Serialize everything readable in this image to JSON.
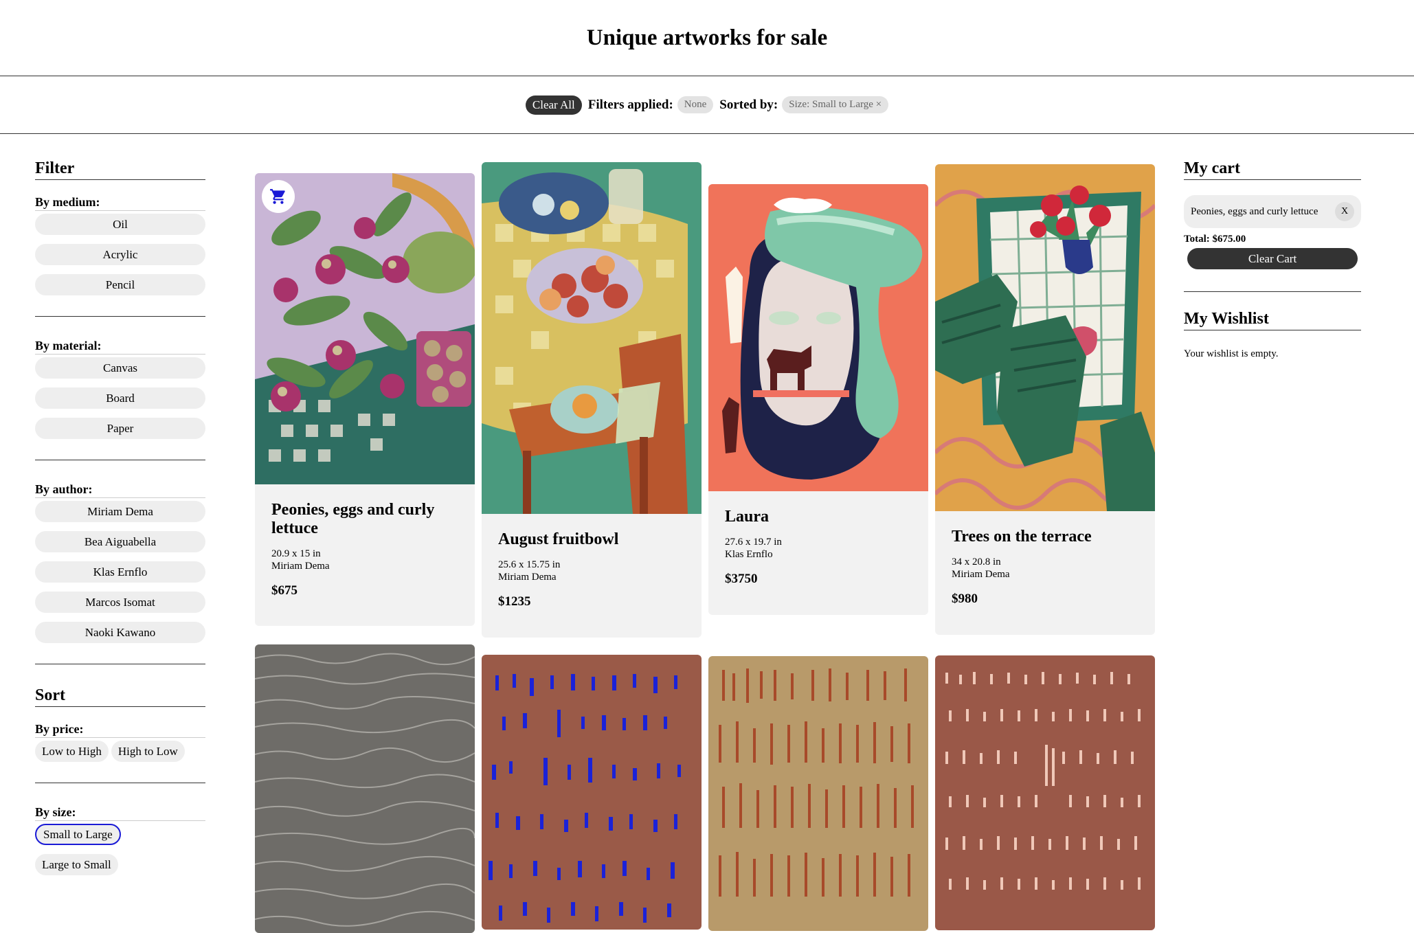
{
  "header": {
    "title": "Unique artworks for sale"
  },
  "filter_bar": {
    "clear_all": "Clear All",
    "filters_label": "Filters applied:",
    "filters_value": "None",
    "sorted_label": "Sorted by:",
    "sorted_value": "Size: Small to Large ×"
  },
  "sidebar": {
    "filter_title": "Filter",
    "medium_label": "By medium:",
    "mediums": [
      "Oil",
      "Acrylic",
      "Pencil"
    ],
    "material_label": "By material:",
    "materials": [
      "Canvas",
      "Board",
      "Paper"
    ],
    "author_label": "By author:",
    "authors": [
      "Miriam Dema",
      "Bea Aiguabella",
      "Klas Ernflo",
      "Marcos Isomat",
      "Naoki Kawano"
    ],
    "sort_title": "Sort",
    "price_label": "By price:",
    "price_options": [
      "Low to High",
      "High to Low"
    ],
    "size_label": "By size:",
    "size_options": [
      "Small to Large",
      "Large to Small"
    ],
    "size_selected": "Small to Large"
  },
  "products": [
    {
      "title": "Peonies, eggs and curly lettuce",
      "size": "20.9 x 15 in",
      "author": "Miriam Dema",
      "price": "$675"
    },
    {
      "title": "August fruitbowl",
      "size": "25.6 x 15.75 in",
      "author": "Miriam Dema",
      "price": "$1235"
    },
    {
      "title": "Laura",
      "size": "27.6 x 19.7 in",
      "author": "Klas Ernflo",
      "price": "$3750"
    },
    {
      "title": "Trees on the terrace",
      "size": "34 x 20.8 in",
      "author": "Miriam Dema",
      "price": "$980"
    }
  ],
  "cart": {
    "title": "My cart",
    "items": [
      "Peonies, eggs and curly lettuce"
    ],
    "remove_label": "X",
    "total": "Total: $675.00",
    "clear_label": "Clear Cart"
  },
  "wishlist": {
    "title": "My Wishlist",
    "empty_text": "Your wishlist is empty."
  },
  "icons": {
    "cart_badge": "shopping-cart-icon"
  },
  "colors": {
    "accent": "#1a1ad6",
    "dark_button": "#333333",
    "card_bg": "#f2f2f2"
  }
}
